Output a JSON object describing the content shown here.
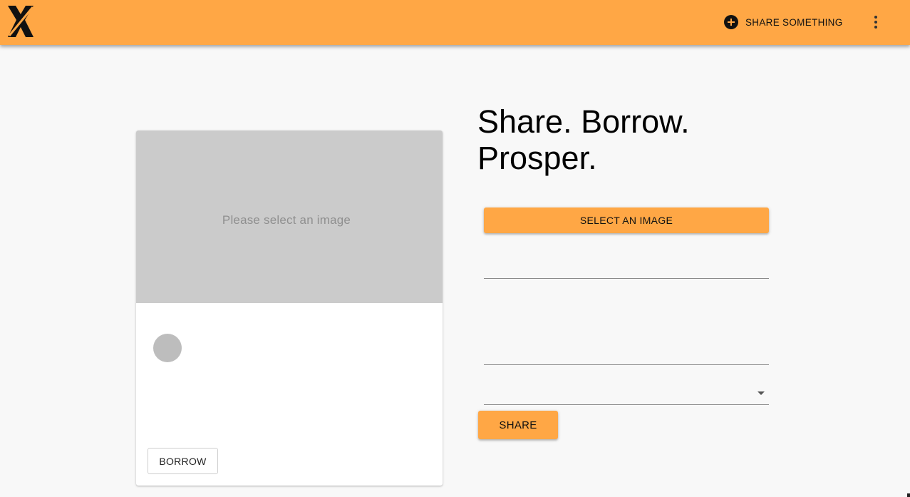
{
  "appbar": {
    "logo_icon": "boomtown-logo-icon",
    "share_something_label": "SHARE SOMETHING",
    "share_something_icon": "add-circle-icon",
    "more_icon": "more-vert-icon",
    "background_color": "#ffa745"
  },
  "preview_card": {
    "image_placeholder": "Please select an image",
    "avatar_icon": "avatar-placeholder",
    "borrow_label": "BORROW"
  },
  "headline": {
    "line1": "Share. Borrow.",
    "line2": "Prosper."
  },
  "form": {
    "select_image_label": "SELECT AN IMAGE",
    "title_value": "",
    "description_value": "",
    "tags_value": "",
    "share_label": "SHARE"
  },
  "colors": {
    "accent": "#ffa745",
    "page_background": "#f8f8f8",
    "media_placeholder": "#cbcbcb"
  }
}
